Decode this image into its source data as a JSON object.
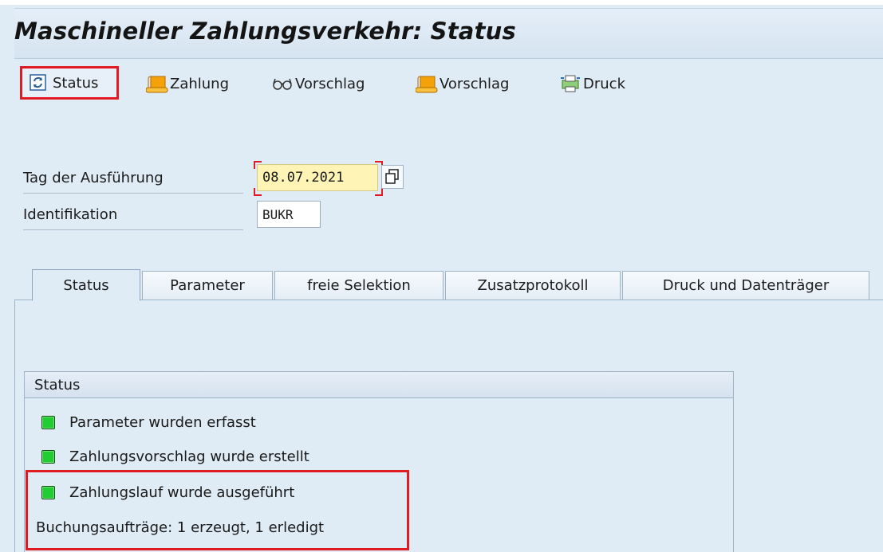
{
  "window": {
    "title": "Maschineller Zahlungsverkehr: Status"
  },
  "toolbar": {
    "status_label": "Status",
    "zahlung_label": "Zahlung",
    "vorschlag1_label": "Vorschlag",
    "vorschlag2_label": "Vorschlag",
    "druck_label": "Druck"
  },
  "form": {
    "date_label": "Tag der Ausführung",
    "date_value": "08.07.2021",
    "id_label": "Identifikation",
    "id_value": "BUKR"
  },
  "tabs": [
    {
      "label": "Status"
    },
    {
      "label": "Parameter"
    },
    {
      "label": "freie Selektion"
    },
    {
      "label": "Zusatzprotokoll"
    },
    {
      "label": "Druck und Datenträger"
    }
  ],
  "status_group": {
    "title": "Status",
    "items": [
      {
        "text": "Parameter wurden erfasst"
      },
      {
        "text": "Zahlungsvorschlag wurde erstellt"
      },
      {
        "text": "Zahlungslauf wurde ausgeführt"
      }
    ],
    "detail": "Buchungsaufträge: 1 erzeugt, 1 erledigt"
  },
  "colors": {
    "highlight": "#e11b22",
    "led_green": "#22cc33",
    "date_field_bg": "#fdf4b5"
  }
}
